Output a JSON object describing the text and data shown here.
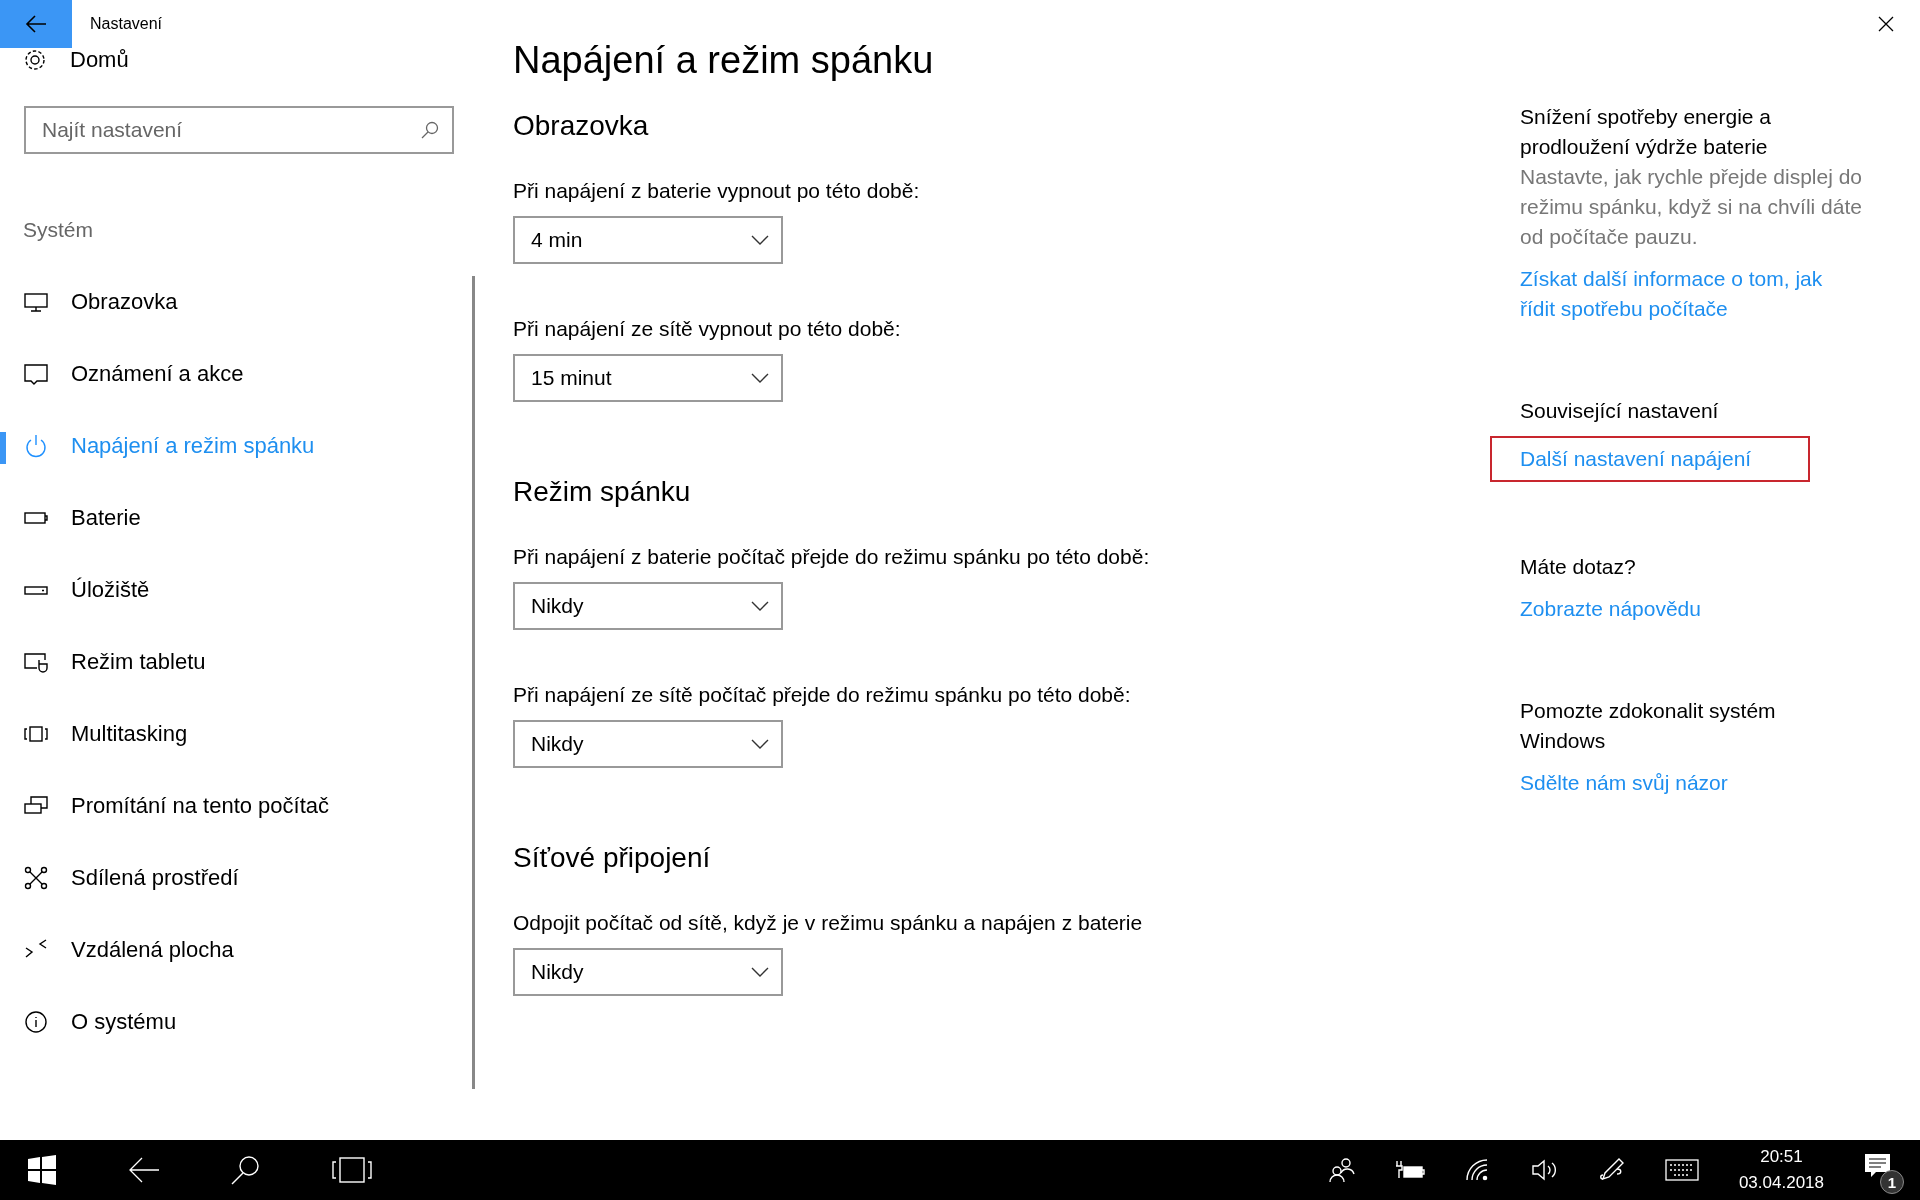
{
  "window": {
    "title": "Nastavení"
  },
  "sidebar": {
    "home": "Domů",
    "search": {
      "placeholder": "Najít nastavení"
    },
    "section": "Systém",
    "items": [
      {
        "label": "Obrazovka",
        "selected": false
      },
      {
        "label": "Oznámení a akce",
        "selected": false
      },
      {
        "label": "Napájení a režim spánku",
        "selected": true
      },
      {
        "label": "Baterie",
        "selected": false
      },
      {
        "label": "Úložiště",
        "selected": false
      },
      {
        "label": "Režim tabletu",
        "selected": false
      },
      {
        "label": "Multitasking",
        "selected": false
      },
      {
        "label": "Promítání na tento počítač",
        "selected": false
      },
      {
        "label": "Sdílená prostředí",
        "selected": false
      },
      {
        "label": "Vzdálená plocha",
        "selected": false
      },
      {
        "label": "O systému",
        "selected": false
      }
    ]
  },
  "page": {
    "title": "Napájení a režim spánku",
    "sections": [
      {
        "heading": "Obrazovka",
        "settings": [
          {
            "label": "Při napájení z baterie vypnout po této době:",
            "value": "4 min"
          },
          {
            "label": "Při napájení ze sítě vypnout po této době:",
            "value": "15 minut"
          }
        ]
      },
      {
        "heading": "Režim spánku",
        "settings": [
          {
            "label": "Při napájení z baterie počítač přejde do režimu spánku po této době:",
            "value": "Nikdy"
          },
          {
            "label": "Při napájení ze sítě počítač přejde do režimu spánku po této době:",
            "value": "Nikdy"
          }
        ]
      },
      {
        "heading": "Síťové připojení",
        "settings": [
          {
            "label": "Odpojit počítač od sítě, když je v režimu spánku a napájen z baterie",
            "value": "Nikdy"
          }
        ]
      }
    ]
  },
  "aside": {
    "groups": [
      {
        "heading": "Snížení spotřeby energie a prodloužení výdrže baterie",
        "text": "Nastavte, jak rychle přejde displej do režimu spánku, když si na chvíli dáte od počítače pauzu.",
        "links": [
          {
            "text": "Získat další informace o tom, jak řídit spotřebu počítače",
            "highlighted": false
          }
        ]
      },
      {
        "heading": "Související nastavení",
        "links": [
          {
            "text": "Další nastavení napájení",
            "highlighted": true
          }
        ]
      },
      {
        "heading": "Máte dotaz?",
        "links": [
          {
            "text": "Zobrazte nápovědu",
            "highlighted": false
          }
        ]
      },
      {
        "heading": "Pomozte zdokonalit systém Windows",
        "links": [
          {
            "text": "Sdělte nám svůj názor",
            "highlighted": false
          }
        ]
      }
    ]
  },
  "taskbar": {
    "time": "20:51",
    "date": "03.04.2018",
    "notifications": "1"
  }
}
